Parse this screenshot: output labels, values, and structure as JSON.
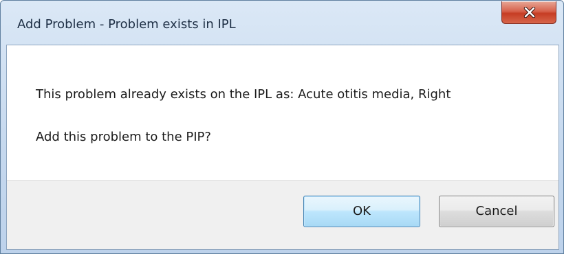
{
  "dialog": {
    "title": "Add Problem - Problem exists in IPL",
    "message_line1": "This problem already exists on the IPL as: Acute otitis media, Right",
    "message_line2": "Add this problem to the PIP?",
    "ok_label": "OK",
    "cancel_label": "Cancel",
    "close_icon": "close-icon"
  },
  "colors": {
    "close_button": "#c63d24",
    "ok_button_border": "#3c7fb1",
    "title_bar": "#c5d8ee",
    "button_area": "#f0f0f0"
  }
}
